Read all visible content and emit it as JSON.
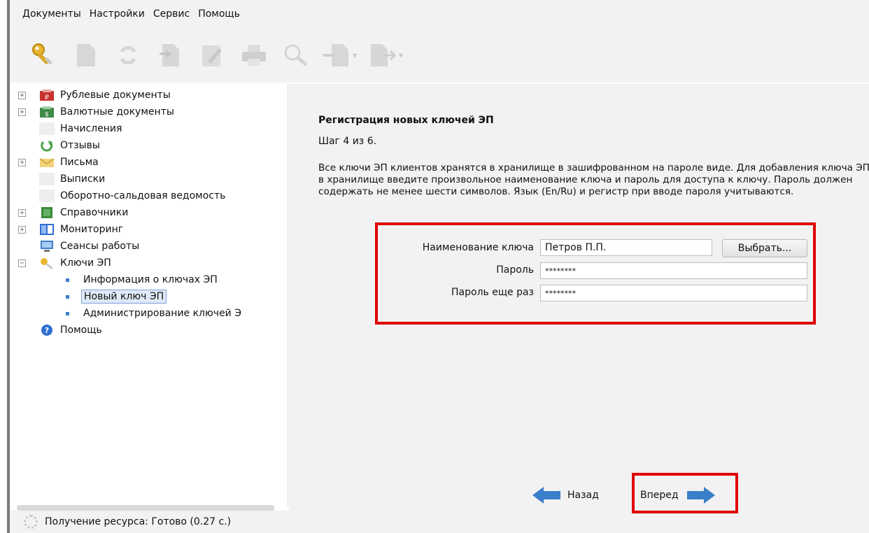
{
  "menu": [
    "Документы",
    "Настройки",
    "Сервис",
    "Помощь"
  ],
  "toolbar": {
    "buttons": [
      "key-icon",
      "document-icon",
      "refresh-icon",
      "import-icon",
      "edit-icon",
      "print-icon",
      "search-icon",
      "export-dropdown-icon",
      "forward-dropdown-icon"
    ]
  },
  "sidebar": {
    "items": [
      {
        "label": "Рублевые документы",
        "icon": "ruble-docs-icon",
        "expandable": true,
        "expander": "+"
      },
      {
        "label": "Валютные документы",
        "icon": "currency-docs-icon",
        "expandable": true,
        "expander": "+"
      },
      {
        "label": "Начисления",
        "icon": "accruals-icon",
        "expandable": false
      },
      {
        "label": "Отзывы",
        "icon": "recall-icon",
        "expandable": false
      },
      {
        "label": "Письма",
        "icon": "letters-icon",
        "expandable": true,
        "expander": "+"
      },
      {
        "label": "Выписки",
        "icon": "statements-icon",
        "expandable": false
      },
      {
        "label": "Оборотно-сальдовая ведомость",
        "icon": "balance-sheet-icon",
        "expandable": false
      },
      {
        "label": "Справочники",
        "icon": "directories-icon",
        "expandable": true,
        "expander": "+"
      },
      {
        "label": "Мониторинг",
        "icon": "monitoring-icon",
        "expandable": true,
        "expander": "+"
      },
      {
        "label": "Сеансы работы",
        "icon": "sessions-icon",
        "expandable": false
      },
      {
        "label": "Ключи ЭП",
        "icon": "keys-icon",
        "expandable": true,
        "expander": "−"
      }
    ],
    "sub_items": [
      "Информация о ключах ЭП",
      "Новый ключ ЭП",
      "Администрирование ключей Э"
    ],
    "help": "Помощь"
  },
  "status": {
    "text": "Получение ресурса: Готово (0.27 с.)"
  },
  "wizard": {
    "title": "Регистрация новых ключей ЭП",
    "step": "Шаг 4 из 6.",
    "description": "Все ключи ЭП клиентов хранятся в хранилище в зашифрованном на пароле виде. Для добавления ключа ЭП в хранилище введите произвольное наименование ключа и пароль для доступа к ключу. Пароль должен содержать не менее шести символов. Язык (En/Ru) и регистр при вводе пароля учитываются.",
    "fields": {
      "key_name_label": "Наименование ключа",
      "key_name_value": "Петров П.П.",
      "choose_label": "Выбрать...",
      "password_label": "Пароль",
      "password_value": "********",
      "password_repeat_label": "Пароль еще раз",
      "password_repeat_value": "********"
    },
    "nav": {
      "back": "Назад",
      "next": "Вперед"
    }
  },
  "colors": {
    "highlight": "#e00000",
    "arrow": "#3a7fc9",
    "panel": "#f2f2f2"
  }
}
